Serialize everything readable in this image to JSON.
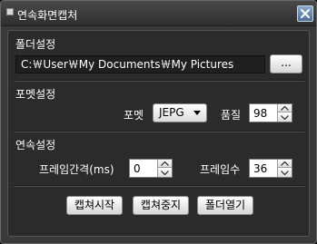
{
  "window": {
    "title": "연속화면캡처",
    "icons": {
      "app": "app-icon",
      "close": "close-icon"
    }
  },
  "folder_section": {
    "title": "폴더설정",
    "path": "C:￦User￦My Documents￦My Pictures",
    "browse_label": "..."
  },
  "format_section": {
    "title": "포멧설정",
    "format_label": "포멧",
    "format_value": "JEPG",
    "quality_label": "품질",
    "quality_value": "98"
  },
  "continuous_section": {
    "title": "연속설정",
    "interval_label": "프레임간격(ms)",
    "interval_value": "0",
    "frames_label": "프레임수",
    "frames_value": "36"
  },
  "actions": {
    "start_label": "캡쳐시작",
    "stop_label": "캡쳐중지",
    "open_folder_label": "폴더열기"
  }
}
